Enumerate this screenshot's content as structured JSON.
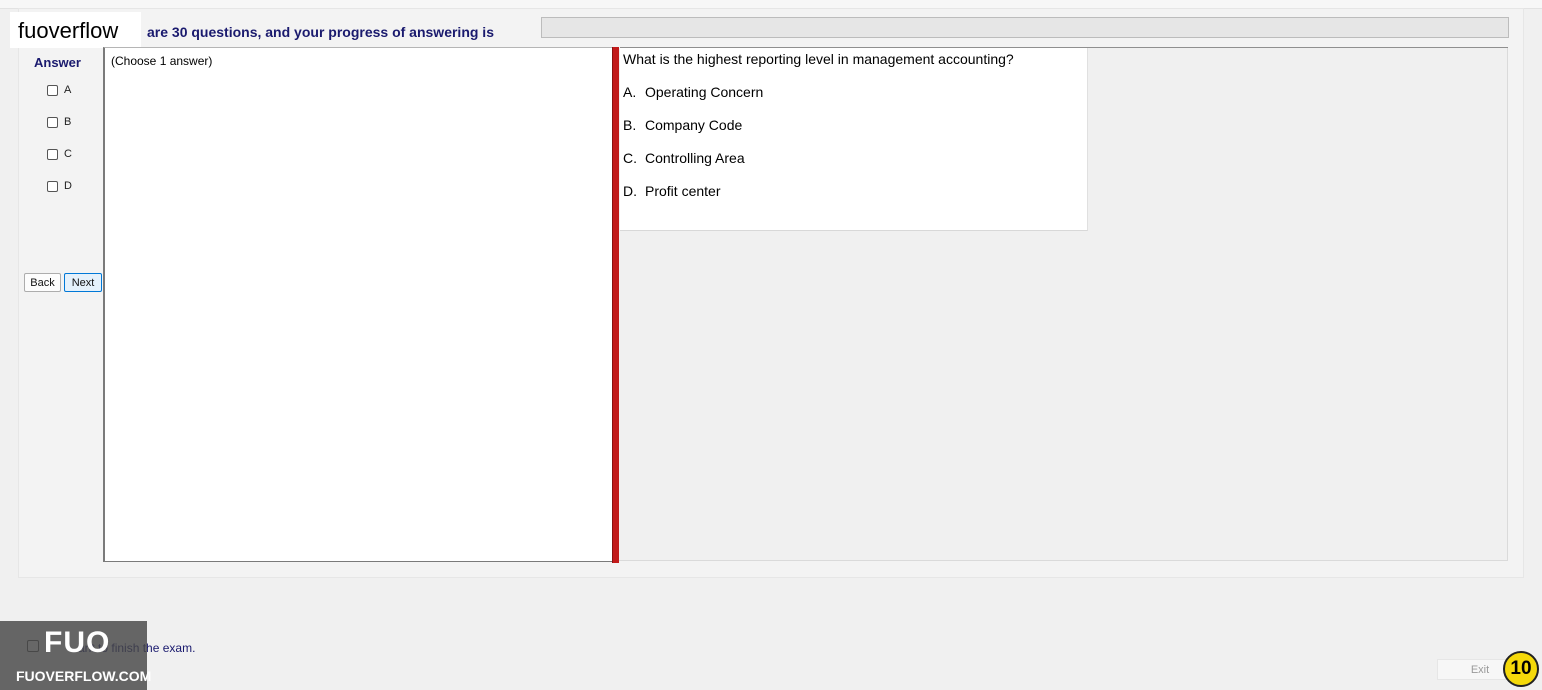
{
  "logo": {
    "text": "fuoverflow"
  },
  "progress": {
    "text": "are 30 questions, and your progress of answering is",
    "value_percent": 0
  },
  "answer_panel": {
    "title": "Answer",
    "options": [
      "A",
      "B",
      "C",
      "D"
    ]
  },
  "nav": {
    "back_label": "Back",
    "next_label": "Next"
  },
  "instruction": "(Choose 1 answer)",
  "question": {
    "text": "What is the highest reporting level in management accounting?",
    "choices": [
      {
        "letter": "A.",
        "text": "Operating Concern"
      },
      {
        "letter": "B.",
        "text": "Company Code"
      },
      {
        "letter": "C.",
        "text": "Controlling Area"
      },
      {
        "letter": "D.",
        "text": "Profit center"
      }
    ]
  },
  "finish": {
    "label": "ant to finish the exam."
  },
  "watermark": {
    "big": "FUO",
    "small": "FUOVERFLOW.COM"
  },
  "exit_label": "Exit",
  "badge": "10",
  "colors": {
    "accent_navy": "#1a1a6e",
    "splitter_red": "#c21a1a",
    "badge_yellow": "#f5d90a"
  }
}
